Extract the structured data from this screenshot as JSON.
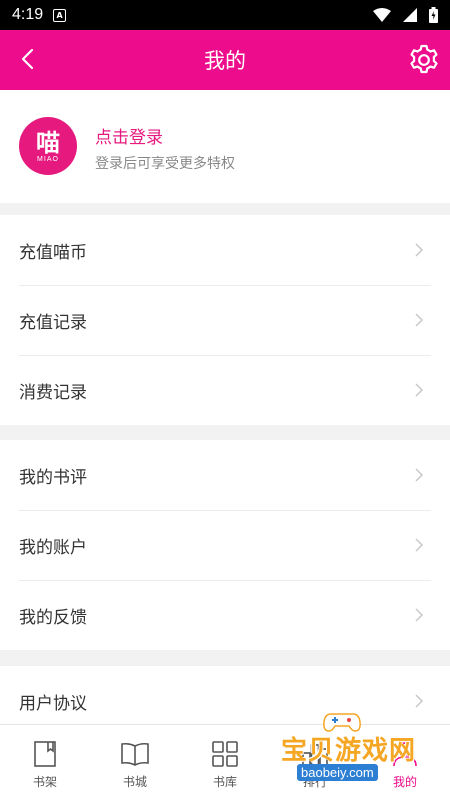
{
  "status_bar": {
    "time": "4:19",
    "notification_glyph": "A"
  },
  "header": {
    "title": "我的",
    "back_icon": "back-arrow-icon",
    "settings_icon": "gear-icon"
  },
  "profile": {
    "avatar_text": "喵",
    "avatar_brand": "MIAO",
    "login_title": "点击登录",
    "login_subtitle": "登录后可享受更多特权"
  },
  "menu_groups": [
    {
      "items": [
        {
          "label": "充值喵币"
        },
        {
          "label": "充值记录"
        },
        {
          "label": "消费记录"
        }
      ]
    },
    {
      "items": [
        {
          "label": "我的书评"
        },
        {
          "label": "我的账户"
        },
        {
          "label": "我的反馈"
        }
      ]
    },
    {
      "items": [
        {
          "label": "用户协议"
        }
      ]
    }
  ],
  "tabs": [
    {
      "label": "书架",
      "icon": "bookshelf-icon"
    },
    {
      "label": "书城",
      "icon": "open-book-icon"
    },
    {
      "label": "书库",
      "icon": "grid-icon"
    },
    {
      "label": "排行",
      "icon": "ranking-icon"
    },
    {
      "label": "我的",
      "icon": "profile-icon",
      "active": true
    }
  ],
  "watermark": {
    "text": "宝贝游戏网",
    "url": "baobeiy.com"
  },
  "colors": {
    "accent": "#ec0c8c",
    "avatar": "#e6197e",
    "watermark": "#f5a623"
  }
}
